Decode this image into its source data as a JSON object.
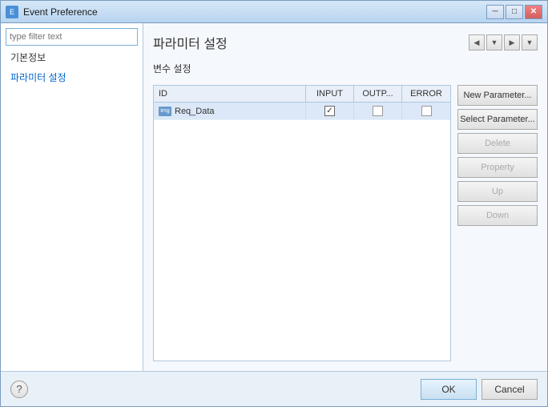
{
  "window": {
    "title": "Event Preference",
    "title_icon": "E"
  },
  "sidebar": {
    "filter_placeholder": "type filter text",
    "items": [
      {
        "label": "기본정보",
        "active": false
      },
      {
        "label": "파라미터 설정",
        "active": true
      }
    ]
  },
  "main": {
    "panel_title": "파라미터 설정",
    "section_label": "변수 설정",
    "table": {
      "headers": [
        "ID",
        "INPUT",
        "OUTP...",
        "ERROR"
      ],
      "rows": [
        {
          "id": "Req_Data",
          "icon": "img",
          "input": true,
          "output": false,
          "error": false
        }
      ]
    },
    "buttons": {
      "new_parameter": "New Parameter...",
      "select_parameter": "Select Parameter...",
      "delete": "Delete",
      "property": "Property",
      "up": "Up",
      "down": "Down"
    }
  },
  "footer": {
    "ok": "OK",
    "cancel": "Cancel"
  },
  "icons": {
    "back_arrow": "◀",
    "forward_arrow": "▶",
    "dropdown": "▼",
    "question_mark": "?"
  }
}
